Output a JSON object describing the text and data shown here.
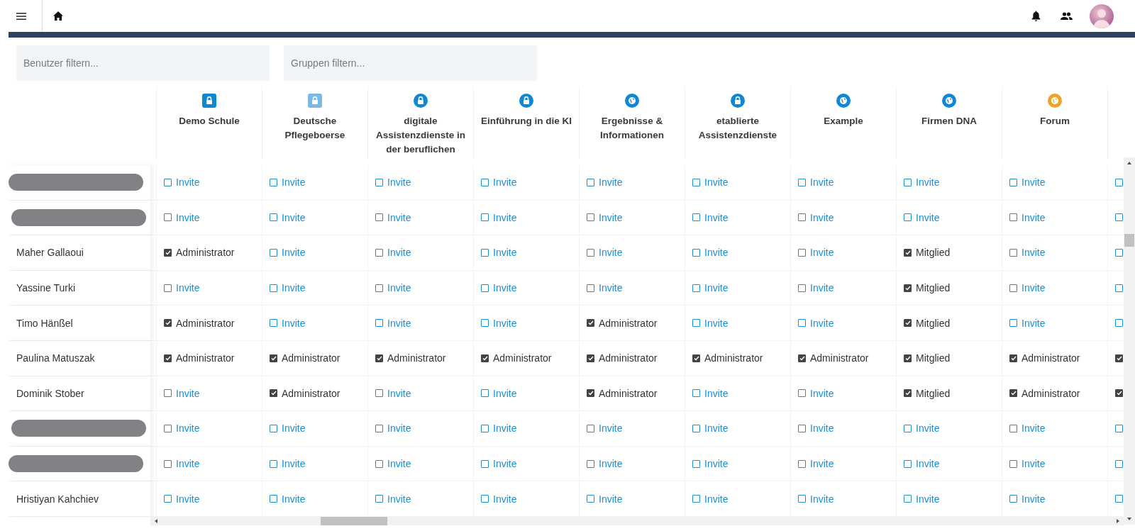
{
  "filters": [
    {
      "placeholder": "Benutzer filtern..."
    },
    {
      "placeholder": "Gruppen filtern..."
    }
  ],
  "groups": [
    {
      "name": "Demo Schule",
      "kind": "locked",
      "color": "#0f87d2"
    },
    {
      "name": "Deutsche Pflegeboerse",
      "kind": "locked",
      "color": "#79b9e6"
    },
    {
      "name": "digitale Assistenzdienste in der beruflichen",
      "kind": "private",
      "color": "#0f87d2"
    },
    {
      "name": "Einführung in die KI",
      "kind": "private",
      "color": "#0f87d2"
    },
    {
      "name": "Ergebnisse & Informationen",
      "kind": "public",
      "color": "#0f87d2"
    },
    {
      "name": "etablierte Assistenzdienste",
      "kind": "private",
      "color": "#0f87d2"
    },
    {
      "name": "Example",
      "kind": "public",
      "color": "#0f87d2"
    },
    {
      "name": "Firmen DNA",
      "kind": "public",
      "color": "#0f87d2"
    },
    {
      "name": "Forum",
      "kind": "public",
      "color": "#f2a127"
    }
  ],
  "users": [
    {
      "redacted": true,
      "cells": [
        {
          "checked": false,
          "label": "Invite"
        },
        {
          "checked": false,
          "label": "Invite"
        },
        {
          "checked": false,
          "label": "Invite"
        },
        {
          "checked": false,
          "label": "Invite"
        },
        {
          "checked": false,
          "label": "Invite"
        },
        {
          "checked": false,
          "label": "Invite"
        },
        {
          "checked": false,
          "label": "Invite"
        },
        {
          "checked": false,
          "label": "Invite"
        },
        {
          "checked": false,
          "label": "Invite"
        },
        {
          "checked": false
        }
      ]
    },
    {
      "redacted": true,
      "cells": [
        {
          "checked": false,
          "label": "Invite"
        },
        {
          "checked": false,
          "label": "Invite"
        },
        {
          "checked": false,
          "label": "Invite"
        },
        {
          "checked": false,
          "label": "Invite"
        },
        {
          "checked": false,
          "label": "Invite"
        },
        {
          "checked": false,
          "label": "Invite"
        },
        {
          "checked": false,
          "label": "Invite"
        },
        {
          "checked": false,
          "label": "Invite"
        },
        {
          "checked": false,
          "label": "Invite"
        },
        {
          "checked": false
        }
      ]
    },
    {
      "name": "Maher Gallaoui",
      "redacted": false,
      "cells": [
        {
          "checked": true,
          "label": "Administrator"
        },
        {
          "checked": false,
          "label": "Invite"
        },
        {
          "checked": false,
          "label": "Invite"
        },
        {
          "checked": false,
          "label": "Invite"
        },
        {
          "checked": false,
          "label": "Invite"
        },
        {
          "checked": false,
          "label": "Invite"
        },
        {
          "checked": false,
          "label": "Invite"
        },
        {
          "checked": true,
          "label": "Mitglied"
        },
        {
          "checked": false,
          "label": "Invite"
        },
        {
          "checked": false
        }
      ]
    },
    {
      "name": "Yassine Turki",
      "redacted": false,
      "cells": [
        {
          "checked": false,
          "label": "Invite"
        },
        {
          "checked": false,
          "label": "Invite"
        },
        {
          "checked": false,
          "label": "Invite"
        },
        {
          "checked": false,
          "label": "Invite"
        },
        {
          "checked": false,
          "label": "Invite"
        },
        {
          "checked": false,
          "label": "Invite"
        },
        {
          "checked": false,
          "label": "Invite"
        },
        {
          "checked": true,
          "label": "Mitglied"
        },
        {
          "checked": false,
          "label": "Invite"
        },
        {
          "checked": false
        }
      ]
    },
    {
      "name": "Timo Hänßel",
      "redacted": false,
      "cells": [
        {
          "checked": true,
          "label": "Administrator"
        },
        {
          "checked": false,
          "label": "Invite"
        },
        {
          "checked": false,
          "label": "Invite"
        },
        {
          "checked": false,
          "label": "Invite"
        },
        {
          "checked": true,
          "label": "Administrator"
        },
        {
          "checked": false,
          "label": "Invite"
        },
        {
          "checked": false,
          "label": "Invite"
        },
        {
          "checked": true,
          "label": "Mitglied"
        },
        {
          "checked": false,
          "label": "Invite"
        },
        {
          "checked": false
        }
      ]
    },
    {
      "name": "Paulina Matuszak",
      "redacted": false,
      "cells": [
        {
          "checked": true,
          "label": "Administrator"
        },
        {
          "checked": true,
          "label": "Administrator"
        },
        {
          "checked": true,
          "label": "Administrator"
        },
        {
          "checked": true,
          "label": "Administrator"
        },
        {
          "checked": true,
          "label": "Administrator"
        },
        {
          "checked": true,
          "label": "Administrator"
        },
        {
          "checked": true,
          "label": "Administrator"
        },
        {
          "checked": true,
          "label": "Mitglied"
        },
        {
          "checked": true,
          "label": "Administrator"
        },
        {
          "checked": true
        }
      ]
    },
    {
      "name": "Dominik Stober",
      "redacted": false,
      "cells": [
        {
          "checked": false,
          "label": "Invite"
        },
        {
          "checked": true,
          "label": "Administrator"
        },
        {
          "checked": false,
          "label": "Invite"
        },
        {
          "checked": false,
          "label": "Invite"
        },
        {
          "checked": true,
          "label": "Administrator"
        },
        {
          "checked": false,
          "label": "Invite"
        },
        {
          "checked": false,
          "label": "Invite"
        },
        {
          "checked": true,
          "label": "Mitglied"
        },
        {
          "checked": true,
          "label": "Administrator"
        },
        {
          "checked": true
        }
      ]
    },
    {
      "redacted": true,
      "cells": [
        {
          "checked": false,
          "label": "Invite"
        },
        {
          "checked": false,
          "label": "Invite"
        },
        {
          "checked": false,
          "label": "Invite"
        },
        {
          "checked": false,
          "label": "Invite"
        },
        {
          "checked": false,
          "label": "Invite"
        },
        {
          "checked": false,
          "label": "Invite"
        },
        {
          "checked": false,
          "label": "Invite"
        },
        {
          "checked": false,
          "label": "Invite"
        },
        {
          "checked": false,
          "label": "Invite"
        },
        {
          "checked": false
        }
      ]
    },
    {
      "redacted": true,
      "cells": [
        {
          "checked": false,
          "label": "Invite"
        },
        {
          "checked": false,
          "label": "Invite"
        },
        {
          "checked": false,
          "label": "Invite"
        },
        {
          "checked": false,
          "label": "Invite"
        },
        {
          "checked": false,
          "label": "Invite"
        },
        {
          "checked": false,
          "label": "Invite"
        },
        {
          "checked": false,
          "label": "Invite"
        },
        {
          "checked": false,
          "label": "Invite"
        },
        {
          "checked": false,
          "label": "Invite"
        },
        {
          "checked": false
        }
      ]
    },
    {
      "name": "Hristiyan Kahchiev",
      "redacted": false,
      "cells": [
        {
          "checked": false,
          "label": "Invite"
        },
        {
          "checked": false,
          "label": "Invite"
        },
        {
          "checked": false,
          "label": "Invite"
        },
        {
          "checked": false,
          "label": "Invite"
        },
        {
          "checked": false,
          "label": "Invite"
        },
        {
          "checked": false,
          "label": "Invite"
        },
        {
          "checked": false,
          "label": "Invite"
        },
        {
          "checked": false,
          "label": "Invite"
        },
        {
          "checked": false,
          "label": "Invite"
        },
        {
          "checked": false
        }
      ]
    }
  ]
}
